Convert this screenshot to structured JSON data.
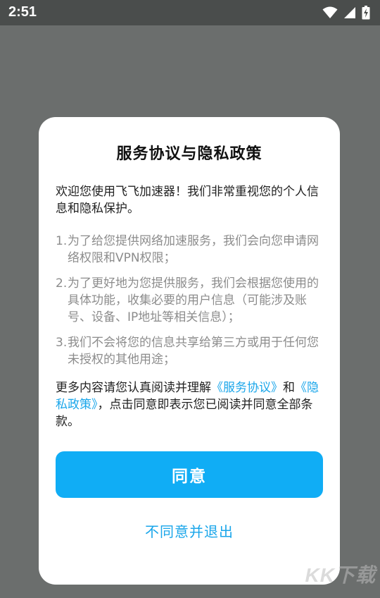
{
  "status_bar": {
    "time": "2:51",
    "icons": [
      "wifi-icon",
      "cell-signal-icon",
      "battery-charging-icon"
    ]
  },
  "dialog": {
    "title": "服务协议与隐私政策",
    "intro": "欢迎您使用飞飞加速器！我们非常重视您的个人信息和隐私保护。",
    "items": [
      {
        "num": "1.",
        "text": "为了给您提供网络加速服务，我们会向您申请网络权限和VPN权限；"
      },
      {
        "num": "2.",
        "text": "为了更好地为您提供服务，我们会根据您使用的具体功能，收集必要的用户信息（可能涉及账号、设备、IP地址等相关信息）；"
      },
      {
        "num": "3.",
        "text": "我们不会将您的信息共享给第三方或用于任何您未授权的其他用途；"
      }
    ],
    "footer": {
      "prefix": "更多内容请您认真阅读并理解",
      "link_service": "《服务协议》",
      "and": "和",
      "link_privacy": "《隐私政策》",
      "suffix": "，点击同意即表示您已阅读并同意全部条款。"
    },
    "agree_label": "同意",
    "decline_label": "不同意并退出"
  },
  "watermark": "KK下载",
  "colors": {
    "accent": "#10adf5",
    "link": "#1aa6ea",
    "overlay": "#6b6e6d",
    "status_bar": "#4a4d4c"
  }
}
